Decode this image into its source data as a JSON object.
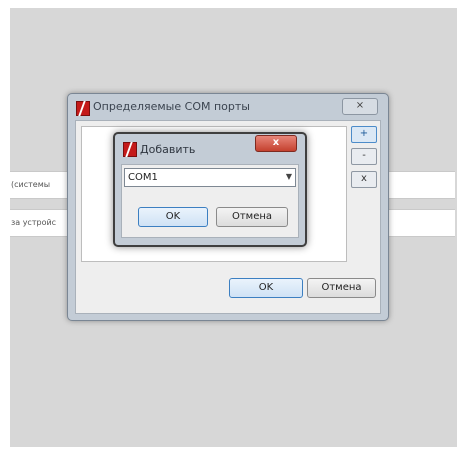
{
  "background": {
    "row1_label": "(системы",
    "row2_label": "за устройс"
  },
  "main_dialog": {
    "title": "Определяемые COM порты",
    "close_label": "⨯",
    "buttons": {
      "add": "+",
      "remove": "-",
      "clear": "x",
      "ok": "OK",
      "cancel": "Отмена"
    }
  },
  "add_dialog": {
    "title": "Добавить",
    "close_label": "x",
    "port_value": "COM1",
    "ok": "OK",
    "cancel": "Отмена"
  },
  "colors": {
    "dialog_frame": "#c3ccd6",
    "client_bg": "#eeeeee",
    "close_red": "#c4412f",
    "default_button_border": "#3c7fc1"
  }
}
